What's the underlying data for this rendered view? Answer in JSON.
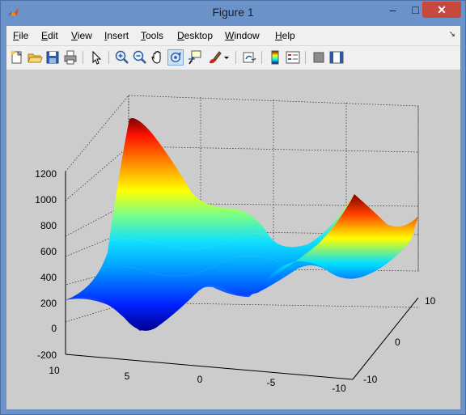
{
  "window": {
    "title": "Figure 1",
    "minimize": "–",
    "maximize": "□",
    "close": "✕"
  },
  "menu": {
    "items": [
      {
        "label": "File",
        "mnemonic": "F",
        "rest": "ile"
      },
      {
        "label": "Edit",
        "mnemonic": "E",
        "rest": "dit"
      },
      {
        "label": "View",
        "mnemonic": "V",
        "rest": "iew"
      },
      {
        "label": "Insert",
        "mnemonic": "I",
        "rest": "nsert"
      },
      {
        "label": "Tools",
        "mnemonic": "T",
        "rest": "ools"
      },
      {
        "label": "Desktop",
        "mnemonic": "D",
        "rest": "esktop"
      },
      {
        "label": "Window",
        "mnemonic": "W",
        "rest": "indow"
      },
      {
        "label": "Help",
        "mnemonic": "H",
        "rest": "elp"
      }
    ],
    "dock_arrow": "↘"
  },
  "toolbar": {
    "icons": [
      "new-figure-icon",
      "open-file-icon",
      "save-icon",
      "print-icon",
      "edit-plot-arrow-icon",
      "zoom-in-icon",
      "zoom-out-icon",
      "pan-hand-icon",
      "rotate-3d-icon",
      "data-cursor-icon",
      "brush-icon",
      "brush-dropdown-icon",
      "link-plot-icon",
      "insert-colorbar-icon",
      "insert-legend-icon",
      "hide-plot-tools-icon",
      "show-plot-tools-icon"
    ],
    "active": "rotate-3d-icon"
  },
  "chart_data": {
    "type": "surface",
    "title": "",
    "x_ticks": [
      "10",
      "5",
      "0",
      "-5",
      "-10"
    ],
    "y_ticks": [
      "-10",
      "0",
      "10"
    ],
    "z_ticks": [
      "-200",
      "0",
      "200",
      "400",
      "600",
      "800",
      "1000",
      "1200"
    ],
    "xlim": [
      -10,
      10
    ],
    "ylim": [
      -10,
      10
    ],
    "zlim": [
      -200,
      1200
    ],
    "colormap": "jet",
    "grid": true
  }
}
